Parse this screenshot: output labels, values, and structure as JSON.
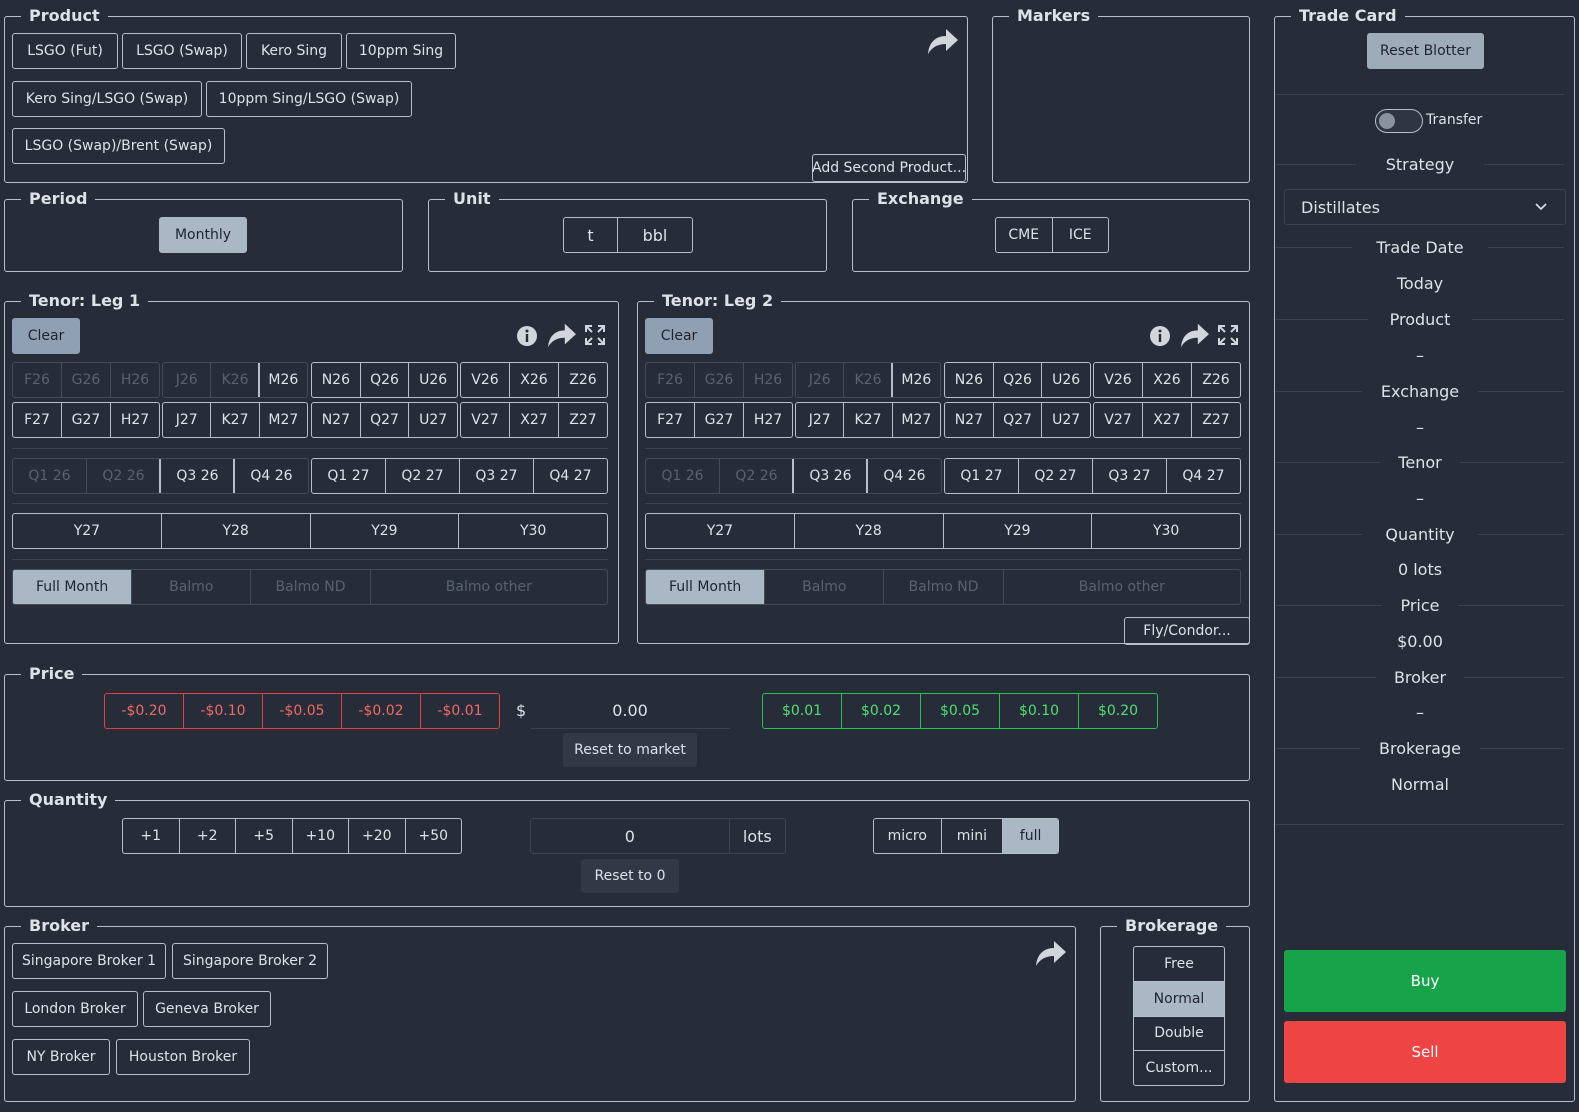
{
  "product": {
    "legend": "Product",
    "items": [
      "LSGO (Fut)",
      "LSGO (Swap)",
      "Kero Sing",
      "10ppm Sing",
      "Kero Sing/LSGO (Swap)",
      "10ppm Sing/LSGO (Swap)",
      "LSGO (Swap)/Brent (Swap)"
    ],
    "add_second": "Add Second Product..."
  },
  "markers": {
    "legend": "Markers"
  },
  "period": {
    "legend": "Period",
    "value": "Monthly"
  },
  "unit": {
    "legend": "Unit",
    "options": [
      "t",
      "bbl"
    ]
  },
  "exchange": {
    "legend": "Exchange",
    "options": [
      "CME",
      "ICE"
    ]
  },
  "tenor1": {
    "legend": "Tenor: Leg 1",
    "clear": "Clear",
    "row1": [
      "F26",
      "G26",
      "H26",
      "J26",
      "K26",
      "M26",
      "N26",
      "Q26",
      "U26",
      "V26",
      "X26",
      "Z26"
    ],
    "row2": [
      "F27",
      "G27",
      "H27",
      "J27",
      "K27",
      "M27",
      "N27",
      "Q27",
      "U27",
      "V27",
      "X27",
      "Z27"
    ],
    "quarters": [
      "Q1 26",
      "Q2 26",
      "Q3 26",
      "Q4 26",
      "Q1 27",
      "Q2 27",
      "Q3 27",
      "Q4 27"
    ],
    "years": [
      "Y27",
      "Y28",
      "Y29",
      "Y30"
    ],
    "modes": [
      "Full Month",
      "Balmo",
      "Balmo ND",
      "Balmo other"
    ]
  },
  "tenor2": {
    "legend": "Tenor: Leg 2",
    "clear": "Clear",
    "row1": [
      "F26",
      "G26",
      "H26",
      "J26",
      "K26",
      "M26",
      "N26",
      "Q26",
      "U26",
      "V26",
      "X26",
      "Z26"
    ],
    "row2": [
      "F27",
      "G27",
      "H27",
      "J27",
      "K27",
      "M27",
      "N27",
      "Q27",
      "U27",
      "V27",
      "X27",
      "Z27"
    ],
    "quarters": [
      "Q1 26",
      "Q2 26",
      "Q3 26",
      "Q4 26",
      "Q1 27",
      "Q2 27",
      "Q3 27",
      "Q4 27"
    ],
    "years": [
      "Y27",
      "Y28",
      "Y29",
      "Y30"
    ],
    "modes": [
      "Full Month",
      "Balmo",
      "Balmo ND",
      "Balmo other"
    ],
    "fly": "Fly/Condor..."
  },
  "price": {
    "legend": "Price",
    "minus": [
      "-$0.20",
      "-$0.10",
      "-$0.05",
      "-$0.02",
      "-$0.01"
    ],
    "plus": [
      "$0.01",
      "$0.02",
      "$0.05",
      "$0.10",
      "$0.20"
    ],
    "currency": "$",
    "value": "0.00",
    "reset": "Reset to market"
  },
  "quantity": {
    "legend": "Quantity",
    "increments": [
      "+1",
      "+2",
      "+5",
      "+10",
      "+20",
      "+50"
    ],
    "value": "0",
    "unit": "lots",
    "sizes": [
      "micro",
      "mini",
      "full"
    ],
    "reset": "Reset to 0"
  },
  "broker": {
    "legend": "Broker",
    "items": [
      "Singapore Broker 1",
      "Singapore Broker 2",
      "London Broker",
      "Geneva Broker",
      "NY Broker",
      "Houston Broker"
    ]
  },
  "brokerage": {
    "legend": "Brokerage",
    "options": [
      "Free",
      "Normal",
      "Double",
      "Custom..."
    ]
  },
  "tradecard": {
    "legend": "Trade Card",
    "reset_blotter": "Reset Blotter",
    "transfer": "Transfer",
    "strategy_label": "Strategy",
    "strategy_value": "Distillates",
    "trade_date_label": "Trade Date",
    "trade_date_value": "Today",
    "product_label": "Product",
    "product_value": "–",
    "exchange_label": "Exchange",
    "exchange_value": "–",
    "tenor_label": "Tenor",
    "tenor_value": "–",
    "quantity_label": "Quantity",
    "quantity_value": "0 lots",
    "price_label": "Price",
    "price_value": "$0.00",
    "broker_label": "Broker",
    "broker_value": "–",
    "brokerage_label": "Brokerage",
    "brokerage_value": "Normal",
    "buy": "Buy",
    "sell": "Sell"
  },
  "colors": {
    "buy": "#16a34a",
    "sell": "#ef4444",
    "selected": "#aab8c6",
    "background": "#262c38"
  }
}
